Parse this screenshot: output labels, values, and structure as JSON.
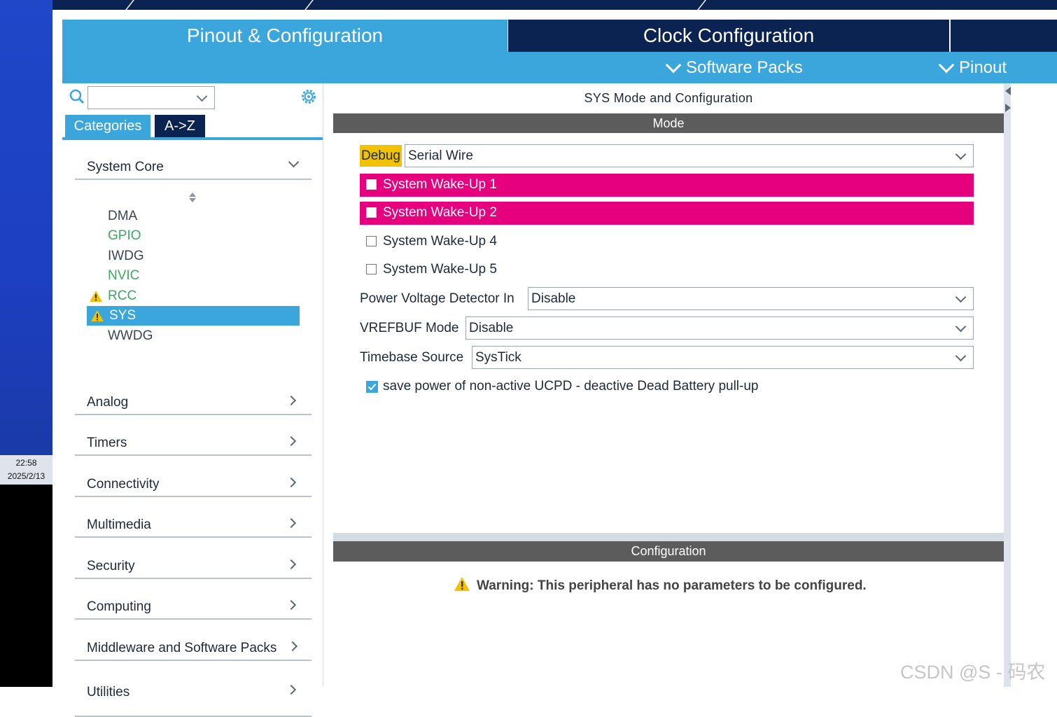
{
  "desktop": {
    "clock_time": "22:58",
    "clock_date": "2025/2/13"
  },
  "tabs": {
    "pinout": "Pinout & Configuration",
    "clock": "Clock Configuration"
  },
  "subbar": {
    "software_packs": "Software Packs",
    "pinout": "Pinout"
  },
  "left": {
    "search_placeholder": "",
    "tab_categories": "Categories",
    "tab_az": "A->Z",
    "system_core": "System Core",
    "peripherals": [
      "DMA",
      "GPIO",
      "IWDG",
      "NVIC",
      "RCC",
      "SYS",
      "WWDG"
    ],
    "categories": [
      "Analog",
      "Timers",
      "Connectivity",
      "Multimedia",
      "Security",
      "Computing",
      "Middleware and Software Packs",
      "Utilities"
    ]
  },
  "right": {
    "title": "SYS Mode and Configuration",
    "mode_header": "Mode",
    "debug_label": "Debug",
    "debug_value": "Serial Wire",
    "wakeups": [
      "System Wake-Up 1",
      "System Wake-Up 2",
      "System Wake-Up 4",
      "System Wake-Up 5"
    ],
    "pvd_label": "Power Voltage Detector In",
    "pvd_value": "Disable",
    "vrefbuf_label": "VREFBUF Mode",
    "vrefbuf_value": "Disable",
    "timebase_label": "Timebase Source",
    "timebase_value": "SysTick",
    "ucpd_label": "save power of non-active UCPD - deactive Dead Battery pull-up",
    "config_header": "Configuration",
    "warning": "Warning: This peripheral has no parameters to be configured."
  },
  "watermark": "CSDN @S - 码农",
  "colors": {
    "accent": "#3aa6dc",
    "navy": "#0a2350",
    "magenta": "#e6007e",
    "warning": "#f2c200",
    "green": "#3aa860"
  }
}
